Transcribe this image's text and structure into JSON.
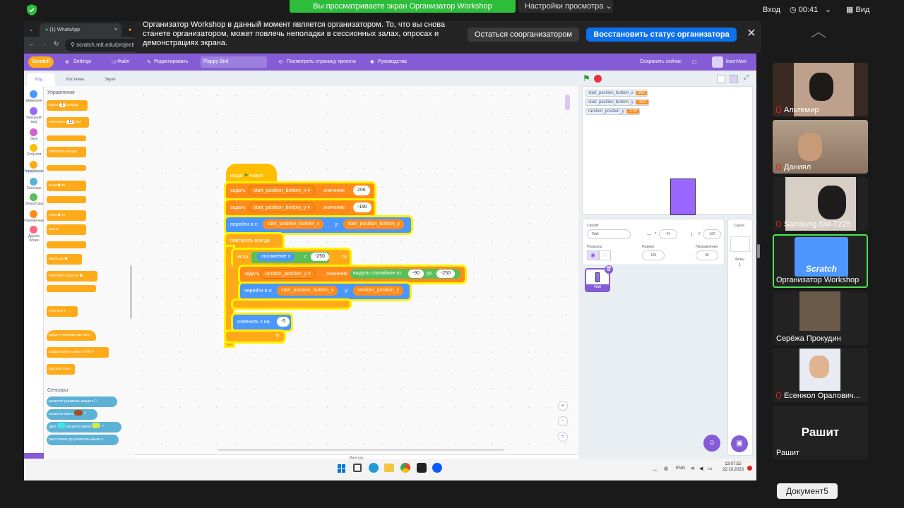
{
  "zoom_bar": {
    "viewing": "Вы просматриваете экран Организатор Workshop",
    "view_settings": "Настройки просмотра",
    "login": "Вход",
    "timer": "00:41",
    "view": "Вид"
  },
  "banner": {
    "text": "Организатор Workshop в данный момент является организатором. То, что вы снова станете организатором, может повлечь неполадки в сессионных залах, опросах и демонстрациях экрана.",
    "stay": "Остаться соорганизатором",
    "restore": "Восстановить статус организатора"
  },
  "browser": {
    "tab1": "(1) WhatsApp",
    "url": "scratch.mit.edu/projects"
  },
  "scratch": {
    "menu": {
      "settings": "Settings",
      "file": "Файл",
      "edit": "Редактировать",
      "project_name": "Flappy Bird",
      "see_project": "Посмотреть страницу проекта",
      "tutorials": "Руководства",
      "save": "Сохранить сейчас",
      "user": "learnVavi"
    },
    "tabs": {
      "code": "Код",
      "costumes": "Костюмы",
      "sounds": "Звуки"
    },
    "categories": [
      {
        "label": "Движение",
        "color": "#4c97ff"
      },
      {
        "label": "Внешний вид",
        "color": "#9966ff"
      },
      {
        "label": "Звук",
        "color": "#cf63cf"
      },
      {
        "label": "События",
        "color": "#ffbf00"
      },
      {
        "label": "Управление",
        "color": "#ffab19"
      },
      {
        "label": "Сенсоры",
        "color": "#5cb1d6"
      },
      {
        "label": "Операторы",
        "color": "#59c059"
      },
      {
        "label": "Переменные",
        "color": "#ff8c1a"
      },
      {
        "label": "Другие блоки",
        "color": "#ff6680"
      }
    ],
    "palette": {
      "control_title": "Управление",
      "wait": "ждать",
      "wait_val": "1",
      "seconds": "секунд",
      "repeat": "повторить",
      "repeat_val": "10",
      "times": "раз",
      "forever": "повторять всегда",
      "if": "если",
      "then": "то",
      "else": "иначе",
      "wait_until": "ждать до",
      "repeat_until": "повторять пока не",
      "stop": "стоп",
      "stop_val": "все",
      "clone_start": "когда я начинаю как клон",
      "create_clone": "создать клон",
      "create_clone_val": "самого себя",
      "delete_clone": "удалить клон",
      "sensing_title": "Сенсоры",
      "touching": "касается",
      "touching_val": "указатель мыши",
      "touching_color": "касается цвета",
      "color": "цвет",
      "touches_color": "касается цвета",
      "distance": "расстояние до",
      "distance_val": "указатель мыши"
    },
    "script": {
      "hat": "когда",
      "hat2": "нажат",
      "set": "задать",
      "to": "значение",
      "var_x": "start_position_bottom_x",
      "val_x": "206",
      "var_y": "start_position_bottom_y",
      "val_y": "-190",
      "goto": "перейти в x:",
      "y": "y:",
      "forever": "повторять всегда",
      "if": "если",
      "pos_x": "положение x",
      "lt": "<",
      "limit": "-250",
      "then": "то",
      "var_rand": "random_position_y",
      "random": "выдать случайное от",
      "from": "-90",
      "to_word": "до",
      "to_val": "-250",
      "change": "изменить x на",
      "change_val": "-5"
    },
    "monitors": [
      {
        "name": "start_position_bottom_x",
        "value": "206"
      },
      {
        "name": "start_position_bottom_y",
        "value": "-190"
      },
      {
        "name": "random_position_y",
        "value": "-170"
      }
    ],
    "sprite": {
      "label": "Спрайт",
      "name": "Wall",
      "x": "41",
      "y": "-100",
      "show": "Показать",
      "size_label": "Размер",
      "size": "100",
      "dir_label": "Направление",
      "dir": "90",
      "thumb": "Wall"
    },
    "stage_panel": {
      "title": "Сцена",
      "backdrops": "Фоны",
      "count": "1"
    },
    "backpack": "Рюкзак",
    "taskbar": {
      "lang": "ENG",
      "time": "13:07:52",
      "date": "22.10.2023"
    }
  },
  "participants": [
    {
      "name": "Альтемир",
      "muted": true
    },
    {
      "name": "Даниял",
      "muted": true
    },
    {
      "name": "Samsung SM-T225",
      "muted": true
    },
    {
      "name": "Организатор Workshop",
      "muted": false
    },
    {
      "name": "Серёжа Прокудин",
      "muted": false
    },
    {
      "name": "Есенжол Оралович...",
      "muted": true
    },
    {
      "name": "Рашит",
      "muted": false,
      "big": "Рашит"
    }
  ],
  "doc_tooltip": "Документ5"
}
